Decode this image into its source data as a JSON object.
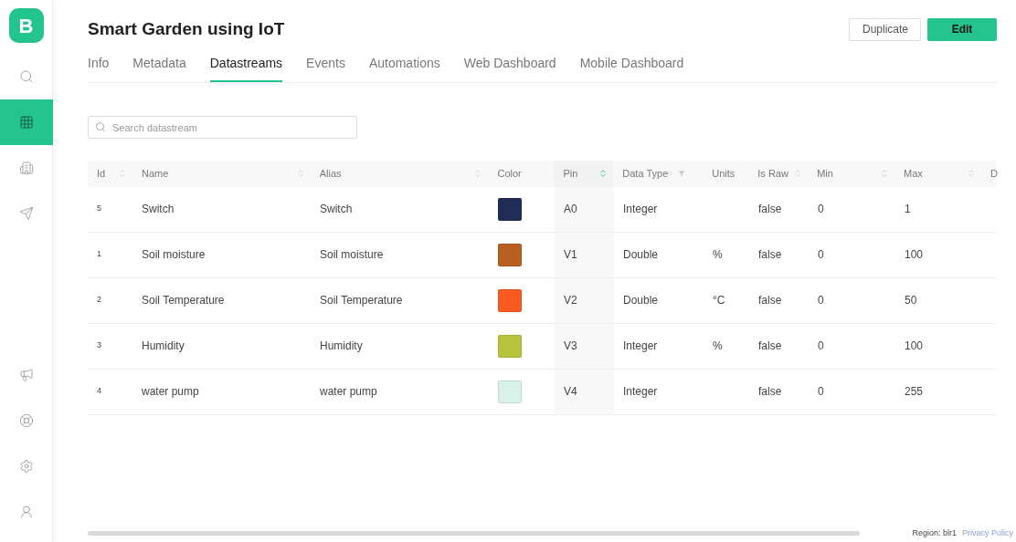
{
  "logo": "B",
  "sidebar": {
    "top": [
      {
        "selected": false
      },
      {
        "selected": true
      },
      {
        "selected": false
      },
      {
        "selected": false
      }
    ],
    "bottom": [
      {
        "selected": false
      },
      {
        "selected": false
      },
      {
        "selected": false
      },
      {
        "selected": false
      }
    ]
  },
  "title": "Smart Garden using IoT",
  "actions": [
    {
      "label": "Duplicate",
      "kind": "secondary"
    },
    {
      "label": "Edit",
      "kind": "primary"
    }
  ],
  "tabs": [
    {
      "label": "Info",
      "selected": false
    },
    {
      "label": "Metadata",
      "selected": false
    },
    {
      "label": "Datastreams",
      "selected": true
    },
    {
      "label": "Events",
      "selected": false
    },
    {
      "label": "Automations",
      "selected": false
    },
    {
      "label": "Web Dashboard",
      "selected": false
    },
    {
      "label": "Mobile Dashboard",
      "selected": false
    }
  ],
  "search": {
    "placeholder": "Search datastream"
  },
  "table": {
    "columns": [
      {
        "label": "Id",
        "sorted": false
      },
      {
        "label": "Name",
        "sorted": false
      },
      {
        "label": "Alias",
        "sorted": false
      },
      {
        "label": "Color"
      },
      {
        "label": "Pin",
        "sorted": true
      },
      {
        "label": "Data Type",
        "sorted": false,
        "filter": true
      },
      {
        "label": "Units"
      },
      {
        "label": "Is Raw",
        "sorted": false
      },
      {
        "label": "Min",
        "sorted": false
      },
      {
        "label": "Max",
        "sorted": false
      },
      {
        "label": "D"
      }
    ],
    "rows": [
      {
        "id": "5",
        "name": "Switch",
        "alias": "Switch",
        "color": "#222d57",
        "pin": "A0",
        "data_type": "Integer",
        "units": "",
        "is_raw": "false",
        "min": "0",
        "max": "1"
      },
      {
        "id": "1",
        "name": "Soil moisture",
        "alias": "Soil moisture",
        "color": "#b8601f",
        "pin": "V1",
        "data_type": "Double",
        "units": "%",
        "is_raw": "false",
        "min": "0",
        "max": "100"
      },
      {
        "id": "2",
        "name": "Soil Temperature",
        "alias": "Soil Temperature",
        "color": "#fb5a20",
        "pin": "V2",
        "data_type": "Double",
        "units": "°C",
        "is_raw": "false",
        "min": "0",
        "max": "50"
      },
      {
        "id": "3",
        "name": "Humidity",
        "alias": "Humidity",
        "color": "#b9c23c",
        "pin": "V3",
        "data_type": "Integer",
        "units": "%",
        "is_raw": "false",
        "min": "0",
        "max": "100"
      },
      {
        "id": "4",
        "name": "water pump",
        "alias": "water pump",
        "color": "#d8f2ea",
        "pin": "V4",
        "data_type": "Integer",
        "units": "",
        "is_raw": "false",
        "min": "0",
        "max": "255"
      }
    ]
  },
  "footer": {
    "region": "Region: blr1",
    "link": "Privacy Policy"
  }
}
